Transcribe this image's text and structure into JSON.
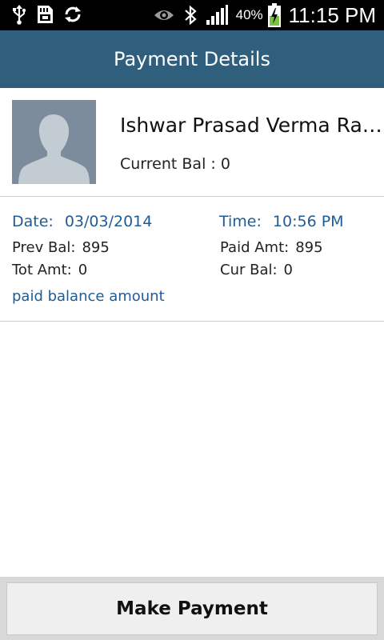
{
  "status_bar": {
    "battery_percent": "40%",
    "time": "11:15 PM",
    "icons": [
      "usb-icon",
      "sd-card-icon",
      "sync-icon",
      "eye-icon",
      "bluetooth-icon",
      "signal-icon",
      "battery-charging-icon"
    ]
  },
  "action_bar": {
    "title": "Payment Details",
    "color": "#2f5f7d"
  },
  "profile": {
    "name": "Ishwar Prasad Verma Ra…",
    "current_balance_label": "Current Bal :",
    "current_balance_value": "0"
  },
  "transaction": {
    "date_label": "Date:",
    "date_value": "03/03/2014",
    "time_label": "Time:",
    "time_value": "10:56 PM",
    "prev_bal_label": "Prev Bal:",
    "prev_bal_value": "895",
    "paid_amt_label": "Paid Amt:",
    "paid_amt_value": "895",
    "tot_amt_label": "Tot Amt:",
    "tot_amt_value": "0",
    "cur_bal_label": "Cur Bal:",
    "cur_bal_value": "0",
    "note": "paid balance amount",
    "accent_color": "#1f5b95"
  },
  "footer": {
    "button_label": "Make Payment"
  }
}
